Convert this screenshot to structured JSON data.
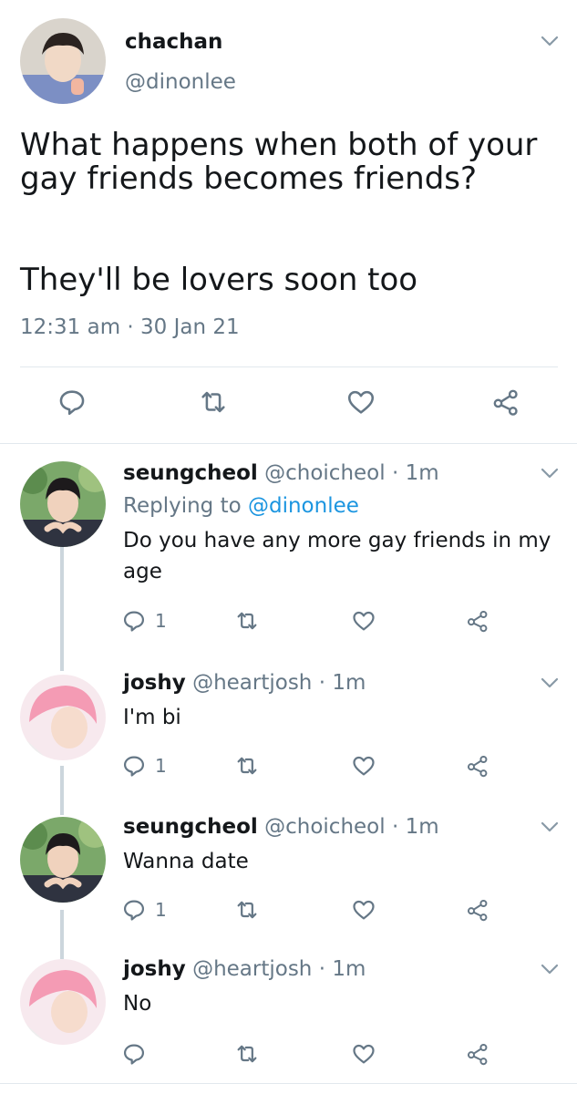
{
  "tweet": {
    "name": "chachan",
    "handle": "@dinonlee",
    "lines": [
      "What happens when both of your gay friends becomes friends?",
      "They'll be lovers soon too"
    ],
    "timestamp": "12:31 am · 30 Jan 21"
  },
  "replies": [
    {
      "name": "seungcheol",
      "handle": "@choicheol",
      "time": "· 1m",
      "replying_prefix": "Replying to ",
      "replying_to": "@dinonlee",
      "text": "Do you have any more gay friends in my age",
      "reply_count": "1"
    },
    {
      "name": "joshy",
      "handle": "@heartjosh",
      "time": "· 1m",
      "text": "I'm bi",
      "reply_count": "1"
    },
    {
      "name": "seungcheol",
      "handle": "@choicheol",
      "time": "· 1m",
      "text": "Wanna date",
      "reply_count": "1"
    },
    {
      "name": "joshy",
      "handle": "@heartjosh",
      "time": "· 1m",
      "text": "No",
      "reply_count": ""
    }
  ],
  "icons": [
    "reply-icon",
    "retweet-icon",
    "like-icon",
    "share-icon",
    "chevron-down-icon"
  ],
  "colors": {
    "text": "#14171a",
    "secondary": "#657786",
    "link": "#1b95e0",
    "divider": "#e1e8ed",
    "thread": "#ccd6dd"
  }
}
